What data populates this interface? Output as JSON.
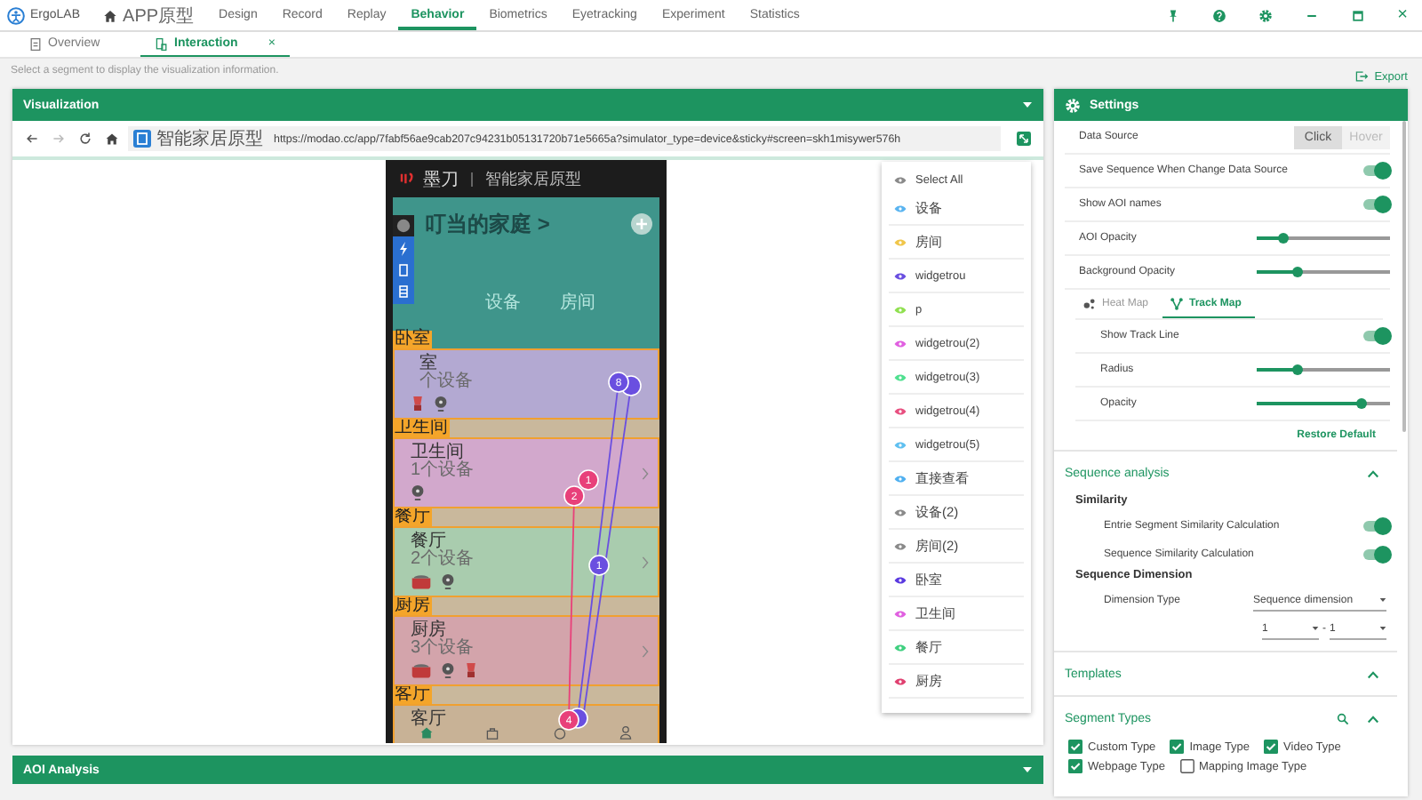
{
  "app": {
    "name": "ErgoLAB"
  },
  "menu": [
    {
      "label": "APP原型",
      "kind": "home",
      "selected": false
    },
    {
      "label": "Design",
      "kind": "text",
      "selected": false
    },
    {
      "label": "Record",
      "kind": "text",
      "selected": false
    },
    {
      "label": "Replay",
      "kind": "text",
      "selected": false
    },
    {
      "label": "Behavior",
      "kind": "text",
      "selected": true
    },
    {
      "label": "Biometrics",
      "kind": "text",
      "selected": false
    },
    {
      "label": "Eyetracking",
      "kind": "text",
      "selected": false
    },
    {
      "label": "Experiment",
      "kind": "text",
      "selected": false
    },
    {
      "label": "Statistics",
      "kind": "text",
      "selected": false
    }
  ],
  "window_controls": {
    "close": "×"
  },
  "doc_tabs": [
    {
      "label": "Overview",
      "kind": "overview",
      "selected": false
    },
    {
      "label": "Interaction",
      "kind": "interaction",
      "selected": true,
      "close": "×"
    }
  ],
  "hint": "Select a segment to display the visualization information.",
  "export": "Export",
  "visualization": {
    "title": "Visualization",
    "page_title": "智能家居原型",
    "url": "https://modao.cc/app/7fabf56ae9cab207c94231b05131720b71e5665a?simulator_type=device&sticky#screen=skh1misywer576h",
    "phone": {
      "brand": "墨刀",
      "title": "智能家居原型",
      "home_title": "叮当的家庭 >",
      "tabs": [
        "设备",
        "房间"
      ],
      "rooms": [
        {
          "aoi": "卧室",
          "name": "室",
          "devices": "个设备",
          "color": "#b3a9d2",
          "icons": [
            {
              "kind": "blender"
            },
            {
              "kind": "fan"
            }
          ]
        },
        {
          "aoi": "卫生间",
          "name": "卫生间",
          "devices": "1个设备",
          "color": "#d2a8cc",
          "icons": [
            {
              "kind": "fan"
            }
          ]
        },
        {
          "aoi": "餐厅",
          "name": "餐厅",
          "devices": "2个设备",
          "color": "#a9ccae",
          "icons": [
            {
              "kind": "pot"
            },
            {
              "kind": "fan"
            }
          ]
        },
        {
          "aoi": "厨房",
          "name": "厨房",
          "devices": "3个设备",
          "color": "#d3a4ab",
          "icons": [
            {
              "kind": "pot"
            },
            {
              "kind": "fan"
            },
            {
              "kind": "blender"
            }
          ]
        },
        {
          "aoi": "客厅",
          "name": "客厅",
          "color": "#c8b296"
        }
      ],
      "points": [
        {
          "label": "8",
          "color": "#6a4fe0"
        },
        {
          "label": "1",
          "color": "#e8407a"
        },
        {
          "label": "2",
          "color": "#e8407a"
        },
        {
          "label": "1",
          "color": "#6a4fe0"
        },
        {
          "label": "4",
          "color": "#e8407a"
        }
      ]
    },
    "aoi_list": [
      {
        "label": "Select All",
        "color": "#8a8a8a"
      },
      {
        "label": "设备",
        "color": "#5ab4f0"
      },
      {
        "label": "房间",
        "color": "#f0c64a"
      },
      {
        "label": "widgetrou",
        "color": "#6a4fe0"
      },
      {
        "label": "p",
        "color": "#90e050"
      },
      {
        "label": "widgetrou(2)",
        "color": "#e060e0"
      },
      {
        "label": "widgetrou(3)",
        "color": "#50e090"
      },
      {
        "label": "widgetrou(4)",
        "color": "#e85080"
      },
      {
        "label": "widgetrou(5)",
        "color": "#60c0f0"
      },
      {
        "label": "直接查看",
        "color": "#50b0f0"
      },
      {
        "label": "设备(2)",
        "color": "#8a8a8a"
      },
      {
        "label": "房间(2)",
        "color": "#8a8a8a"
      },
      {
        "label": "卧室",
        "color": "#5a3ae0"
      },
      {
        "label": "卫生间",
        "color": "#e060e0"
      },
      {
        "label": "餐厅",
        "color": "#40d080"
      },
      {
        "label": "厨房",
        "color": "#e04070"
      }
    ]
  },
  "settings": {
    "title": "Settings",
    "data_source": {
      "label": "Data Source",
      "options": [
        {
          "label": "Click",
          "selected": true
        },
        {
          "label": "Hover",
          "selected": false
        }
      ]
    },
    "rows": [
      {
        "kind": "toggle",
        "label": "Save Sequence When Change Data Source",
        "on": true
      },
      {
        "kind": "toggle",
        "label": "Show AOI names",
        "on": true
      },
      {
        "kind": "slider",
        "label": "AOI Opacity",
        "level": 0.2
      },
      {
        "kind": "slider",
        "label": "Background Opacity",
        "level": 0.31
      }
    ],
    "map_tabs": [
      {
        "label": "Heat Map",
        "kind": "heat",
        "selected": false
      },
      {
        "label": "Track Map",
        "kind": "track",
        "selected": true
      }
    ],
    "map_rows": [
      {
        "kind": "toggle",
        "label": "Show Track Line",
        "on": true
      },
      {
        "kind": "slider",
        "label": "Radius",
        "level": 0.31
      },
      {
        "kind": "slider",
        "label": "Opacity",
        "level": 0.79
      }
    ],
    "restore": "Restore Default"
  },
  "sequence": {
    "title": "Sequence analysis",
    "expanded": true,
    "similarity": "Similarity",
    "toggles": [
      {
        "label": "Entrie Segment Similarity Calculation",
        "on": true
      },
      {
        "label": "Sequence Similarity Calculation",
        "on": true
      }
    ],
    "dimension": "Sequence Dimension",
    "dimension_type": {
      "label": "Dimension Type",
      "value": "Sequence dimension"
    },
    "range_from": "1",
    "range_sep": "-",
    "range_to": "1"
  },
  "templates": {
    "title": "Templates",
    "expanded": true
  },
  "segment_types": {
    "title": "Segment Types",
    "expanded": true,
    "types": [
      {
        "label": "Custom Type",
        "checked": true
      },
      {
        "label": "Image Type",
        "checked": true
      },
      {
        "label": "Video Type",
        "checked": true
      },
      {
        "label": "Webpage Type",
        "checked": true
      },
      {
        "label": "Mapping Image Type",
        "checked": false
      }
    ]
  },
  "aoi_analysis": {
    "title": "AOI Analysis"
  }
}
